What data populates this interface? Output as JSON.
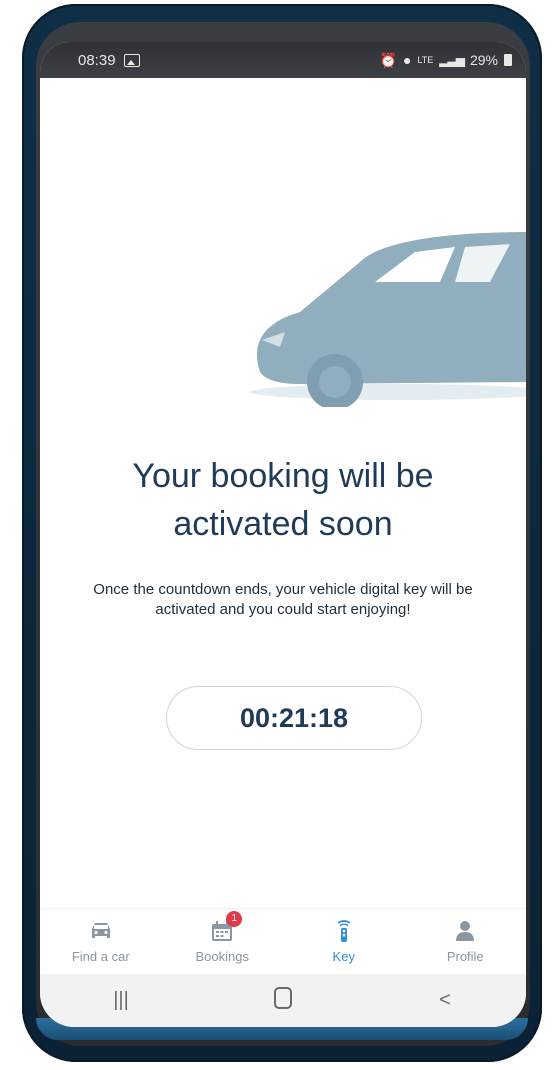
{
  "status_bar": {
    "time": "08:39",
    "battery": "29%",
    "network": "LTE"
  },
  "main": {
    "headline": "Your booking will be activated soon",
    "subtext": "Once the countdown ends, your vehicle digital key will be activated and you could start enjoying!",
    "countdown": "00:21:18"
  },
  "tabbar": {
    "items": [
      {
        "label": "Find a car",
        "icon": "car-icon"
      },
      {
        "label": "Bookings",
        "icon": "calendar-icon",
        "badge": "1"
      },
      {
        "label": "Key",
        "icon": "key-fob-icon"
      },
      {
        "label": "Profile",
        "icon": "person-icon"
      }
    ],
    "active": "Key"
  },
  "nav_bar": {
    "recents": "|||",
    "back": "<"
  },
  "colors": {
    "accent": "#2f8fd8",
    "headline": "#1f3b57",
    "car": "#90aebd",
    "badge": "#e0394a",
    "inactive_tab": "#8a96a2"
  }
}
